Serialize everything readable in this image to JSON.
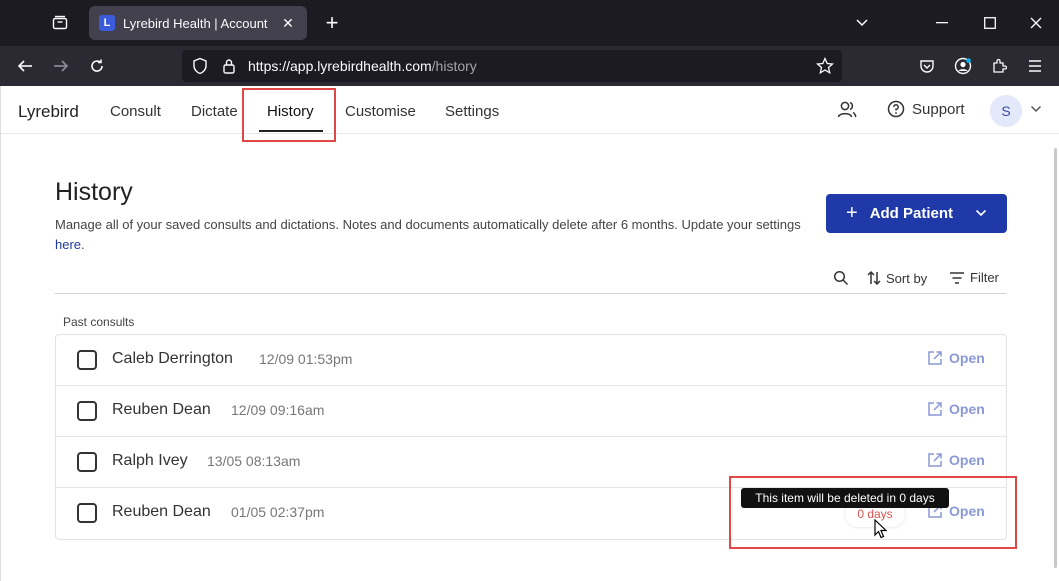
{
  "browser": {
    "tab_title": "Lyrebird Health | Account",
    "tab_favicon_letter": "L",
    "url_host": "https://app.lyrebirdhealth.com",
    "url_path": "/history"
  },
  "nav": {
    "brand": "Lyrebird",
    "links": [
      {
        "label": "Consult"
      },
      {
        "label": "Dictate"
      },
      {
        "label": "History"
      },
      {
        "label": "Customise"
      },
      {
        "label": "Settings"
      }
    ],
    "active": "History",
    "support_label": "Support",
    "avatar_initial": "S"
  },
  "page": {
    "title": "History",
    "description": "Manage all of your saved consults and dictations. Notes and documents automatically delete after 6 months. Update your settings",
    "description_link": "here",
    "description_end": ".",
    "add_button_label": "Add Patient"
  },
  "toolbar": {
    "sort_label": "Sort by",
    "filter_label": "Filter"
  },
  "list": {
    "section_label": "Past consults",
    "open_label": "Open",
    "items": [
      {
        "name": "Caleb Derrington",
        "time": "12/09 01:53pm"
      },
      {
        "name": "Reuben Dean",
        "time": "12/09 09:16am"
      },
      {
        "name": "Ralph Ivey",
        "time": "13/05 08:13am"
      },
      {
        "name": "Reuben Dean",
        "time": "01/05 02:37pm",
        "days": "0 days"
      }
    ]
  },
  "tooltip": "This item will be deleted in 0 days",
  "colors": {
    "accent": "#1f3aa8",
    "highlight": "#e04848",
    "open_link": "#8a98d6",
    "days_badge_text": "#d9534f"
  }
}
